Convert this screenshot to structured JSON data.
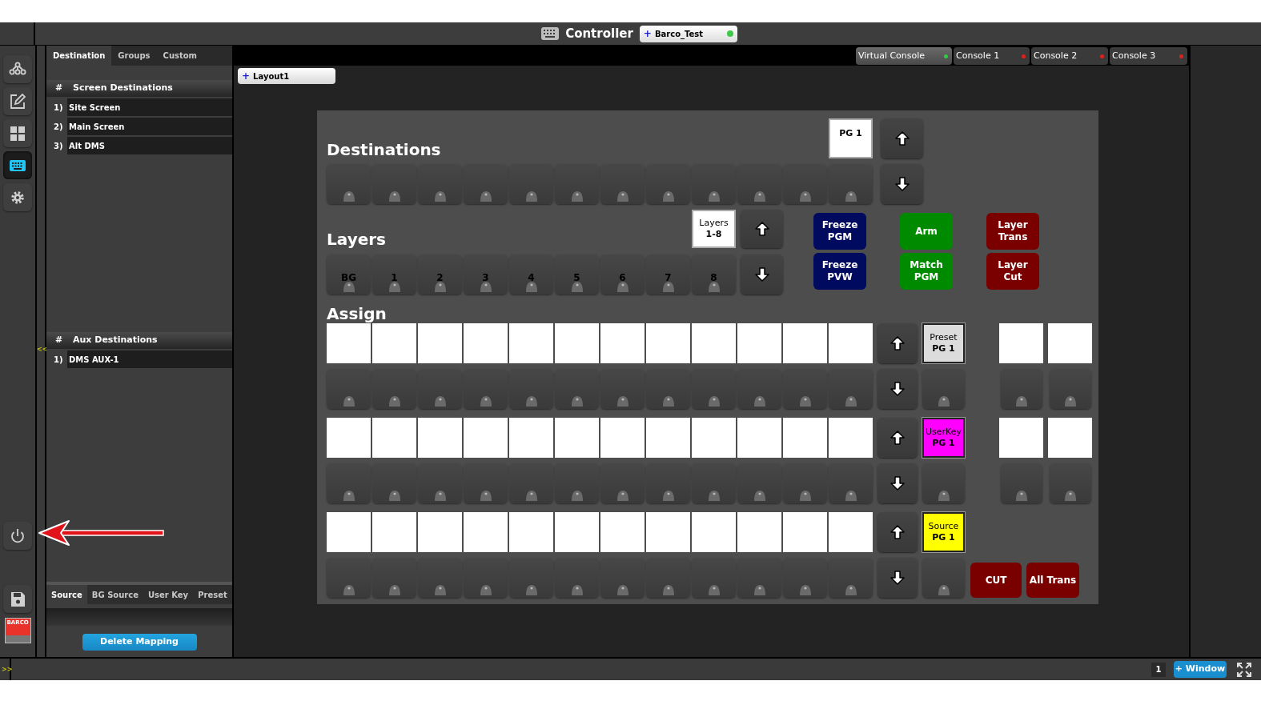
{
  "title_bar": {
    "title": "Controller",
    "system_tab": {
      "prefix": "+",
      "label": "Barco_Test",
      "color": "#3ec94a"
    }
  },
  "rail_icons": [
    {
      "kind": "network",
      "selected": false
    },
    {
      "kind": "edit",
      "selected": false
    },
    {
      "kind": "grid",
      "selected": false
    },
    {
      "kind": "keyboard",
      "selected": true
    },
    {
      "kind": "settings",
      "selected": false
    }
  ],
  "rail_bottom_icons": [
    {
      "kind": "power"
    },
    {
      "kind": "save"
    }
  ],
  "logo": {
    "text": "BARCO"
  },
  "collapse_marker": "<<",
  "panel": {
    "tabs": [
      {
        "label": "Destination",
        "selected": true
      },
      {
        "label": "Groups",
        "selected": false
      },
      {
        "label": "Custom",
        "selected": false
      }
    ],
    "screen_header": {
      "hash": "#",
      "title": "Screen Destinations"
    },
    "screen_items": [
      {
        "number": "1)",
        "label": "Site Screen"
      },
      {
        "number": "2)",
        "label": "Main Screen"
      },
      {
        "number": "3)",
        "label": "Alt DMS"
      }
    ],
    "aux_header": {
      "hash": "#",
      "title": "Aux Destinations"
    },
    "aux_items": [
      {
        "number": "1)",
        "label": "DMS AUX-1"
      }
    ],
    "bottom_tabs": [
      {
        "label": "Source",
        "selected": true
      },
      {
        "label": "BG Source",
        "selected": false
      },
      {
        "label": "User Key",
        "selected": false
      },
      {
        "label": "Preset",
        "selected": false
      }
    ],
    "delete_button": "Delete Mapping"
  },
  "console_tabs": [
    {
      "label": "Virtual Console",
      "selected": true,
      "color": "#2ecc40"
    },
    {
      "label": "Console 1",
      "selected": false,
      "color": "#e0201a"
    },
    {
      "label": "Console 2",
      "selected": false,
      "color": "#e0201a"
    },
    {
      "label": "Console 3",
      "selected": false,
      "color": "#e0201a"
    }
  ],
  "layout_tab": {
    "prefix": "+",
    "label": "Layout1"
  },
  "destinations": {
    "heading": "Destinations",
    "page_label": "PG 1"
  },
  "layers": {
    "heading": "Layers",
    "page_title": "Layers",
    "page_label": "1-8",
    "buttons": [
      "BG",
      "1",
      "2",
      "3",
      "4",
      "5",
      "6",
      "7",
      "8"
    ]
  },
  "function_buttons": [
    {
      "label": "Freeze PGM",
      "color": "#000a5e"
    },
    {
      "label": "Freeze PVW",
      "color": "#000a5e"
    },
    {
      "label": "Arm",
      "color": "#008a00"
    },
    {
      "label": "Match PGM",
      "color": "#008a00"
    },
    {
      "label": "Layer Trans",
      "color": "#7a0000"
    },
    {
      "label": "Layer Cut",
      "color": "#7a0000"
    }
  ],
  "assign": {
    "heading": "Assign",
    "rows": [
      {
        "page_title": "Preset",
        "page_label": "PG 1",
        "color": "#dcdcdc",
        "side_slots": true
      },
      {
        "page_title": "UserKey",
        "page_label": "PG 1",
        "color": "#ff00ff",
        "side_slots": true
      },
      {
        "page_title": "Source",
        "page_label": "PG 1",
        "color": "#ffff00",
        "side_slots": false
      }
    ]
  },
  "transition_buttons": [
    {
      "label": "CUT"
    },
    {
      "label": "All Trans"
    }
  ],
  "status_bar": {
    "expand_marker": ">>",
    "page": "1",
    "window_button": "+ Window"
  }
}
